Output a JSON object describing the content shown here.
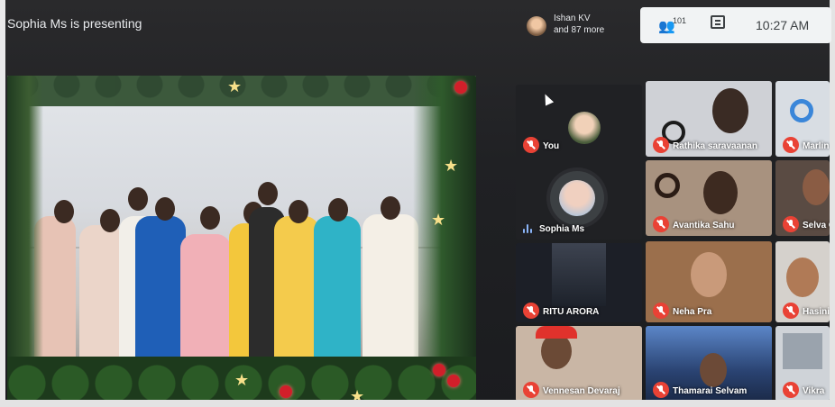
{
  "presenting_label": "Sophia Ms is presenting",
  "viewers": {
    "name": "Ishan KV",
    "more": "and 87 more"
  },
  "toolbar": {
    "people_count": "101",
    "time": "10:27 AM"
  },
  "participants": [
    {
      "name": "You",
      "muted": true
    },
    {
      "name": "Sophia Ms",
      "muted": false,
      "speaking": true
    },
    {
      "name": "RITU ARORA",
      "muted": true
    },
    {
      "name": "Rathika saravaanan",
      "muted": true
    },
    {
      "name": "Marlin R",
      "muted": true
    },
    {
      "name": "Avantika Sahu",
      "muted": true
    },
    {
      "name": "Selva G",
      "muted": true
    },
    {
      "name": "Neha Pra",
      "muted": true
    },
    {
      "name": "Hasini",
      "muted": true
    },
    {
      "name": "Vennesan Devaraj",
      "muted": true
    },
    {
      "name": "Thamarai Selvam",
      "muted": true
    },
    {
      "name": "Vikra",
      "muted": true
    }
  ],
  "colors": {
    "mic_off": "#e94235",
    "accent": "#8ab4f8",
    "topbar": "#f1f3f4"
  }
}
